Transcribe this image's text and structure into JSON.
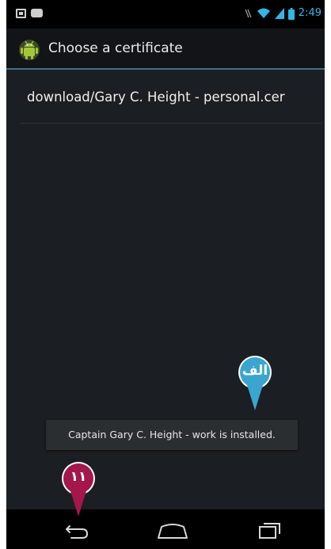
{
  "status_bar": {
    "time": "2:49",
    "left_icons": [
      "screenshot-icon",
      "usb-debug-icon"
    ],
    "right_icons": [
      "wifi-icon",
      "signal-icon",
      "battery-icon"
    ]
  },
  "action_bar": {
    "icon": "android-icon",
    "title": "Choose a certificate"
  },
  "list": {
    "items": [
      {
        "label": "download/Gary C. Height - personal.cer"
      }
    ]
  },
  "toast": {
    "text": "Captain Gary C. Height - work is installed."
  },
  "nav_bar": {
    "buttons": [
      "back-icon",
      "home-icon",
      "recents-icon"
    ]
  },
  "callouts": [
    {
      "label": "الف",
      "color": "#3aa6cf"
    },
    {
      "label": "۱۱",
      "color": "#a3174a"
    }
  ],
  "colors": {
    "screen_background": "#1b1e22",
    "accent_blue": "#33b5e5",
    "toast_background": "#2b2e31"
  }
}
